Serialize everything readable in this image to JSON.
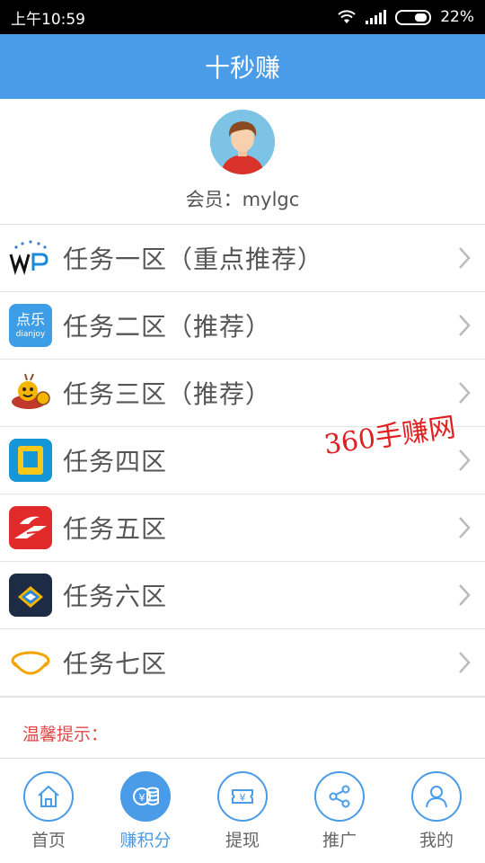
{
  "status_bar": {
    "time": "上午10:59",
    "battery": "22%"
  },
  "header": {
    "title": "十秒赚"
  },
  "profile": {
    "member_text": "会员：mylgc"
  },
  "tasks": [
    {
      "label": "任务一区（重点推荐）",
      "icon": "wp-logo-icon"
    },
    {
      "label": "任务二区（推荐）",
      "icon": "dianjoy-logo-icon",
      "icon_text": "点乐",
      "icon_subtext": "dianjoy"
    },
    {
      "label": "任务三区（推荐）",
      "icon": "mascot-logo-icon"
    },
    {
      "label": "任务四区",
      "icon": "blue-square-logo-icon"
    },
    {
      "label": "任务五区",
      "icon": "red-wing-logo-icon"
    },
    {
      "label": "任务六区",
      "icon": "dark-book-logo-icon"
    },
    {
      "label": "任务七区",
      "icon": "bowl-logo-icon"
    }
  ],
  "watermark": "360手赚网",
  "tip": {
    "label": "温馨提示："
  },
  "tabbar": {
    "items": [
      {
        "label": "首页",
        "icon": "home-icon",
        "active": false
      },
      {
        "label": "赚积分",
        "icon": "coins-icon",
        "active": true
      },
      {
        "label": "提现",
        "icon": "ticket-yen-icon",
        "active": false
      },
      {
        "label": "推广",
        "icon": "share-icon",
        "active": false
      },
      {
        "label": "我的",
        "icon": "user-icon",
        "active": false
      }
    ]
  },
  "colors": {
    "primary": "#4a9be8",
    "tip_red": "#e04848",
    "watermark_red": "#e02020"
  }
}
